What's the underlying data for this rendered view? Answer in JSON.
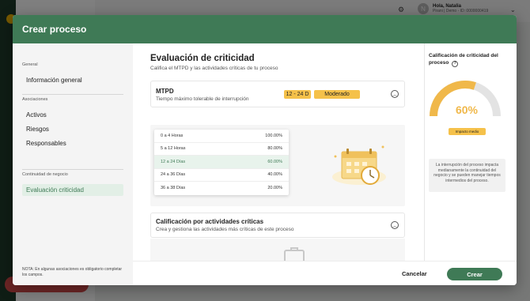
{
  "background": {
    "user_name": "Hola, Natalia",
    "user_sub": "Pirani | Demo - ID: 0000000419",
    "avatar_initial": "N",
    "red_button_label": "Ver planes"
  },
  "modal": {
    "title": "Crear proceso"
  },
  "nav": {
    "sections": [
      {
        "label": "General",
        "items": [
          {
            "label": "Información general",
            "active": false
          }
        ]
      },
      {
        "label": "Asociaciones",
        "items": [
          {
            "label": "Activos",
            "active": false
          },
          {
            "label": "Riesgos",
            "active": false
          },
          {
            "label": "Responsables",
            "active": false
          }
        ]
      },
      {
        "label": "Continuidad de negocio",
        "items": [
          {
            "label": "Evaluación criticidad",
            "active": true
          }
        ]
      }
    ],
    "note": "NOTA: En algunas asociaciones es obligatorio completar los campos."
  },
  "main": {
    "title": "Evaluación de criticidad",
    "subtitle": "Califica el MTPD y las actividades críticas de tu proceso",
    "mtpd": {
      "title": "MTPD",
      "subtitle": "Tiempo máximo tolerable de interrupción",
      "range_chip": "12 - 24 D",
      "level_chip": "Moderado",
      "options": [
        {
          "label": "0 a 4 Horas",
          "value": "100.00%",
          "selected": false
        },
        {
          "label": "5 a 12 Horas",
          "value": "80.00%",
          "selected": false
        },
        {
          "label": "12 a 24 Días",
          "value": "60.00%",
          "selected": true
        },
        {
          "label": "24 a 36 Días",
          "value": "40.00%",
          "selected": false
        },
        {
          "label": "36 a 38 Días",
          "value": "20.00%",
          "selected": false
        }
      ]
    },
    "activities": {
      "title": "Calificación por actividades críticas",
      "subtitle": "Crea y gestiona las actividades más críticas de este proceso"
    }
  },
  "right_panel": {
    "title": "Calificación de criticidad del proceso",
    "help_icon": "question-circle-icon",
    "gauge_value": 0.6,
    "gauge_label": "60%",
    "impact_badge": "Impacto medio",
    "impact_note": "La interrupción del proceso impacta medianamente la continuidad del negocio y se pueden manejar tiempos intermedios del proceso.",
    "colors": {
      "gauge_fill": "#f0b84a",
      "gauge_track": "#e3e3e3"
    }
  },
  "footer": {
    "cancel_label": "Cancelar",
    "create_label": "Crear"
  },
  "colors": {
    "brand": "#3f7a56",
    "accent": "#f5c14a"
  }
}
